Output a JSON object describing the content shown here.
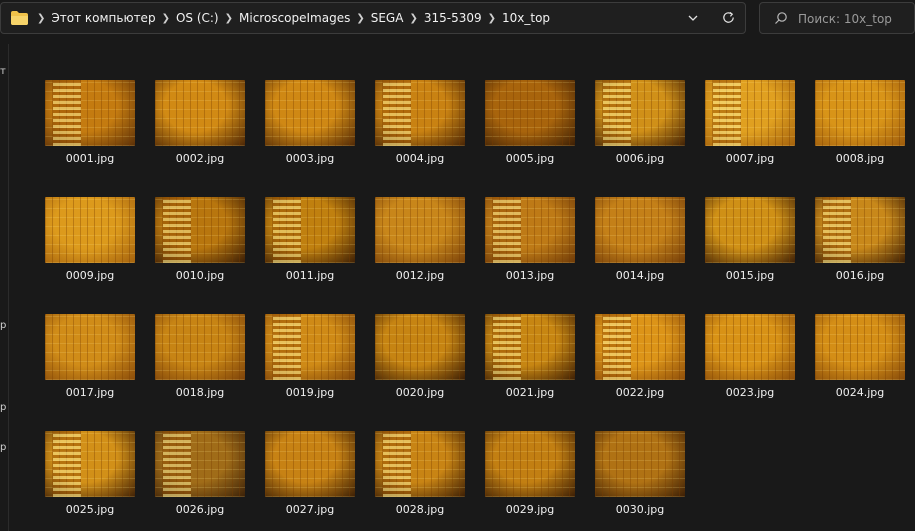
{
  "address": {
    "crumbs": [
      "Этот компьютер",
      "OS (C:)",
      "MicroscopeImages",
      "SEGA",
      "315-5309",
      "10x_top"
    ]
  },
  "search": {
    "placeholder": "Поиск: 10x_top"
  },
  "files": [
    {
      "name": "0001.jpg",
      "c1": "#c47b10",
      "c2": "#5a2f08"
    },
    {
      "name": "0002.jpg",
      "c1": "#d18a14",
      "c2": "#4a2506"
    },
    {
      "name": "0003.jpg",
      "c1": "#cf8814",
      "c2": "#4e2807"
    },
    {
      "name": "0004.jpg",
      "c1": "#c98212",
      "c2": "#472406"
    },
    {
      "name": "0005.jpg",
      "c1": "#a8640c",
      "c2": "#3b1e05"
    },
    {
      "name": "0006.jpg",
      "c1": "#d09018",
      "c2": "#3e2006"
    },
    {
      "name": "0007.jpg",
      "c1": "#e0a020",
      "c2": "#a2600c"
    },
    {
      "name": "0008.jpg",
      "c1": "#d89418",
      "c2": "#9c5a0c"
    },
    {
      "name": "0009.jpg",
      "c1": "#dc9a1c",
      "c2": "#a4620e"
    },
    {
      "name": "0010.jpg",
      "c1": "#b8760e",
      "c2": "#3a1d05"
    },
    {
      "name": "0011.jpg",
      "c1": "#c0800f",
      "c2": "#3d1f05"
    },
    {
      "name": "0012.jpg",
      "c1": "#c8861a",
      "c2": "#7a420a"
    },
    {
      "name": "0013.jpg",
      "c1": "#be7a16",
      "c2": "#6e3a08"
    },
    {
      "name": "0014.jpg",
      "c1": "#c48018",
      "c2": "#733d09"
    },
    {
      "name": "0015.jpg",
      "c1": "#cf9016",
      "c2": "#3e2006"
    },
    {
      "name": "0016.jpg",
      "c1": "#c8881a",
      "c2": "#3a1e05"
    },
    {
      "name": "0017.jpg",
      "c1": "#d08c18",
      "c2": "#8a4c0a"
    },
    {
      "name": "0018.jpg",
      "c1": "#c78414",
      "c2": "#7c420a"
    },
    {
      "name": "0019.jpg",
      "c1": "#cf8a16",
      "c2": "#7e440a"
    },
    {
      "name": "0020.jpg",
      "c1": "#c68412",
      "c2": "#3a1d05"
    },
    {
      "name": "0021.jpg",
      "c1": "#c78612",
      "c2": "#3d1f05"
    },
    {
      "name": "0022.jpg",
      "c1": "#dc9418",
      "c2": "#8e4e0a"
    },
    {
      "name": "0023.jpg",
      "c1": "#d89216",
      "c2": "#8a4c0a"
    },
    {
      "name": "0024.jpg",
      "c1": "#d48e16",
      "c2": "#864a0a"
    },
    {
      "name": "0025.jpg",
      "c1": "#d29018",
      "c2": "#3e2006"
    },
    {
      "name": "0026.jpg",
      "c1": "#a06c18",
      "c2": "#3a2008"
    },
    {
      "name": "0027.jpg",
      "c1": "#c78214",
      "c2": "#3a1e05"
    },
    {
      "name": "0028.jpg",
      "c1": "#c88414",
      "c2": "#3b1e05"
    },
    {
      "name": "0029.jpg",
      "c1": "#c27f12",
      "c2": "#3a1d05"
    },
    {
      "name": "0030.jpg",
      "c1": "#b07214",
      "c2": "#3a1d05"
    }
  ],
  "leftnav": [
    "т",
    "",
    "",
    "",
    "",
    "",
    "",
    "р",
    "",
    "р",
    "р"
  ]
}
